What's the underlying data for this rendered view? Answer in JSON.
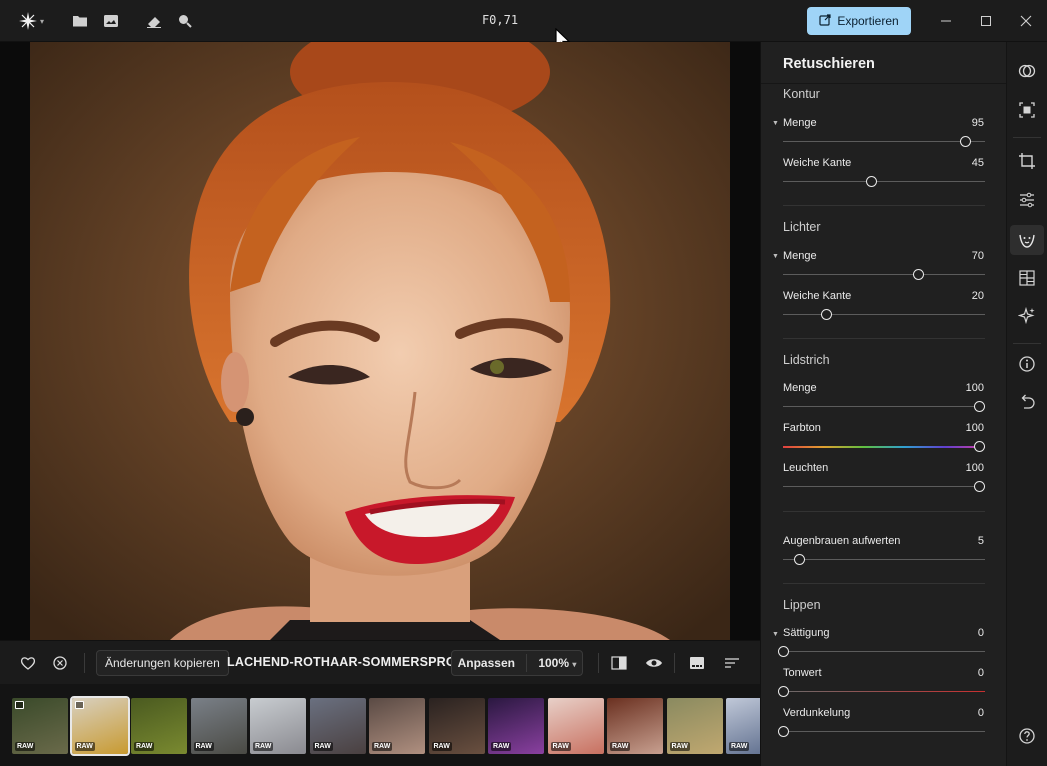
{
  "titlebar": {
    "title": "F0,71",
    "export_label": "Exportieren"
  },
  "bottombar": {
    "copy_changes_label": "Änderungen kopieren",
    "filename": "LACHEND-ROTHAAR-SOMMERSPROS...",
    "fit_label": "Anpassen",
    "zoom_label": "100%"
  },
  "filmstrip": {
    "raw_badge": "RAW",
    "thumbs": [
      {
        "color_a": "#3a4a2a",
        "color_b": "#6a6a4a",
        "edited": true
      },
      {
        "color_a": "#d8d0c0",
        "color_b": "#c89a30",
        "edited": true
      },
      {
        "color_a": "#4a5a20",
        "color_b": "#7a8a30",
        "edited": false
      },
      {
        "color_a": "#7a8088",
        "color_b": "#4a4a44",
        "edited": false
      },
      {
        "color_a": "#c8ccd0",
        "color_b": "#8a8a90",
        "edited": false
      },
      {
        "color_a": "#6a7080",
        "color_b": "#4a4040",
        "edited": false
      },
      {
        "color_a": "#5a4a44",
        "color_b": "#b09080",
        "edited": false
      },
      {
        "color_a": "#2a2220",
        "color_b": "#6a5040",
        "edited": false
      },
      {
        "color_a": "#2a1840",
        "color_b": "#8a40a0",
        "edited": false
      },
      {
        "color_a": "#e8d0c8",
        "color_b": "#c87060",
        "edited": false
      },
      {
        "color_a": "#6a3020",
        "color_b": "#c8a090",
        "edited": false
      },
      {
        "color_a": "#8a8a60",
        "color_b": "#c0a870",
        "edited": false
      },
      {
        "color_a": "#c0c8d8",
        "color_b": "#5a6a8a",
        "edited": false
      }
    ]
  },
  "panel": {
    "title": "Retuschieren",
    "sections": {
      "kontur": "Kontur",
      "lichter": "Lichter",
      "lidstrich": "Lidstrich",
      "lippen": "Lippen"
    },
    "sliders": {
      "kontur_menge": {
        "label": "Menge",
        "value": "95",
        "fraction": 0.93
      },
      "kontur_weiche_kante": {
        "label": "Weiche Kante",
        "value": "45",
        "fraction": 0.45
      },
      "lichter_menge": {
        "label": "Menge",
        "value": "70",
        "fraction": 0.69
      },
      "lichter_weiche_kante": {
        "label": "Weiche Kante",
        "value": "20",
        "fraction": 0.22
      },
      "lidstrich_menge": {
        "label": "Menge",
        "value": "100",
        "fraction": 1.0
      },
      "lidstrich_farbton": {
        "label": "Farbton",
        "value": "100",
        "fraction": 1.0
      },
      "lidstrich_leuchten": {
        "label": "Leuchten",
        "value": "100",
        "fraction": 1.0
      },
      "augenbrauen": {
        "label": "Augenbrauen aufwerten",
        "value": "5",
        "fraction": 0.08
      },
      "lippen_saettigung": {
        "label": "Sättigung",
        "value": "0",
        "fraction": 0.0
      },
      "lippen_tonwert": {
        "label": "Tonwert",
        "value": "0",
        "fraction": 0.0
      },
      "lippen_verdunkelung": {
        "label": "Verdunkelung",
        "value": "0",
        "fraction": 0.0
      }
    }
  },
  "colors": {
    "accent": "#9fd4f7",
    "panel_bg": "#202020"
  }
}
